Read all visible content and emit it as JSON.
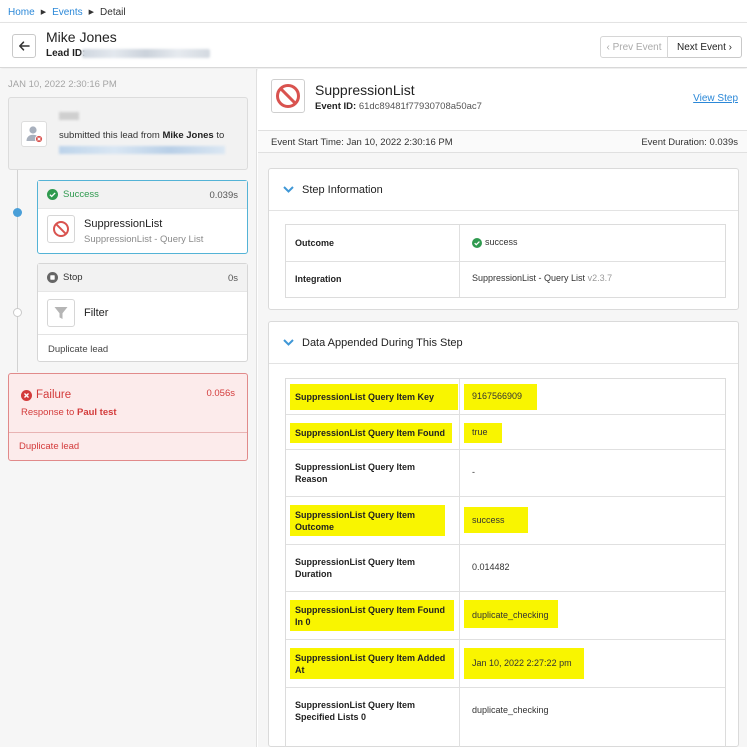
{
  "breadcrumb": {
    "home": "Home",
    "events": "Events",
    "current": "Detail"
  },
  "header": {
    "lead_name": "Mike Jones",
    "lead_id_label": "Lead ID:",
    "prev_label": "‹ Prev Event",
    "next_label": "Next Event ›"
  },
  "timeline": {
    "timestamp": "JAN 10, 2022 2:30:16 PM",
    "submit": {
      "prefix": "submitted this lead from ",
      "name": "Mike Jones",
      "suffix": " to"
    },
    "steps": [
      {
        "status": "Success",
        "duration": "0.039s",
        "title": "SuppressionList",
        "subtitle": "SuppressionList - Query List"
      },
      {
        "status": "Stop",
        "duration": "0s",
        "title": "Filter",
        "reason": "Duplicate lead"
      }
    ],
    "failure": {
      "title": "Failure",
      "duration": "0.056s",
      "response_prefix": "Response to ",
      "response_name": "Paul test",
      "reason": "Duplicate lead"
    }
  },
  "event": {
    "title": "SuppressionList",
    "id_label": "Event ID:",
    "id": "61dc89481f77930708a50ac7",
    "view_step": "View Step",
    "start_time": "Event Start Time: Jan 10, 2022 2:30:16 PM",
    "duration": "Event Duration: 0.039s"
  },
  "step_information": {
    "title": "Step Information",
    "rows": [
      {
        "key": "Outcome",
        "value": "success"
      },
      {
        "key": "Integration",
        "value": "SuppressionList - Query List",
        "version": "v2.3.7"
      }
    ]
  },
  "data_appended": {
    "title": "Data Appended During This Step",
    "rows": [
      {
        "key": "SuppressionList Query Item Key",
        "value": "9167566909",
        "highlighted": true
      },
      {
        "key": "SuppressionList Query Item Found",
        "value": "true",
        "highlighted": true
      },
      {
        "key": "SuppressionList Query Item Reason",
        "value": "-",
        "highlighted": false
      },
      {
        "key": "SuppressionList Query Item Outcome",
        "value": "success",
        "highlighted": true
      },
      {
        "key": "SuppressionList Query Item Duration",
        "value": "0.014482",
        "highlighted": false
      },
      {
        "key": "SuppressionList Query Item Found In 0",
        "value": "duplicate_checking",
        "highlighted": true
      },
      {
        "key": "SuppressionList Query Item Added At",
        "value": "Jan 10, 2022 2:27:22 pm",
        "highlighted": true
      },
      {
        "key": "SuppressionList Query Item Specified Lists 0",
        "value": "duplicate_checking",
        "highlighted": false
      }
    ]
  },
  "colors": {
    "accent_blue": "#2b88d8",
    "success_green": "#2f9a4f",
    "failure_red": "#d33b3b",
    "highlight_yellow": "#f9f500"
  }
}
